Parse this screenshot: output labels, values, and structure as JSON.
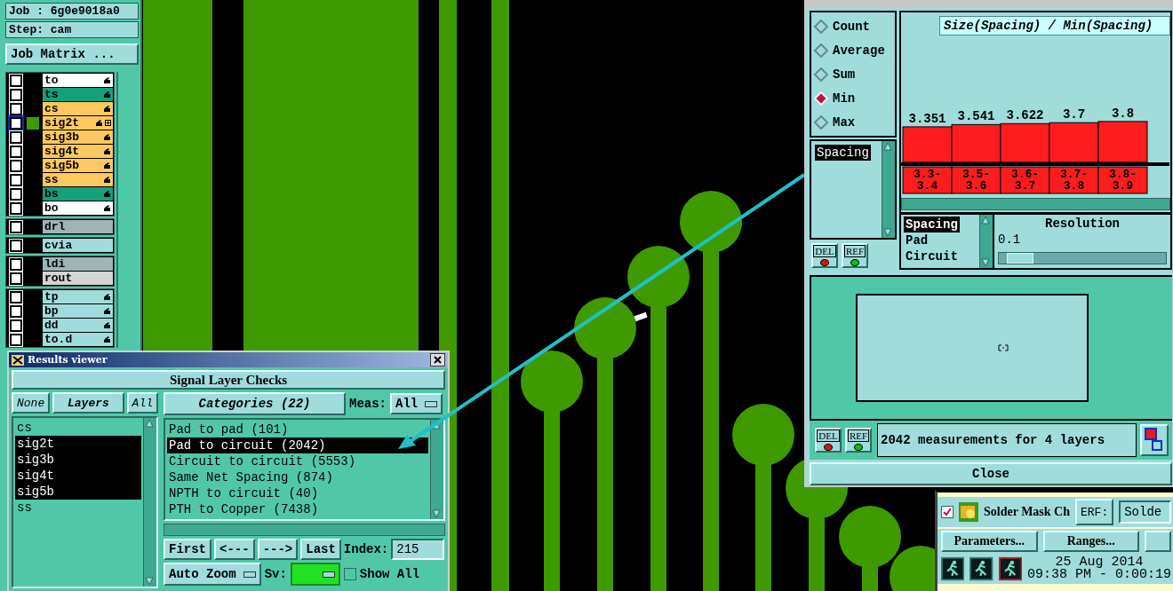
{
  "left_panel": {
    "job": "Job : 6g0e9018a0",
    "step": "Step: cam",
    "matrix_button": "Job Matrix ...",
    "layer_groups": [
      {
        "layers": [
          {
            "name": "to",
            "color": "#ffffff",
            "checked": false,
            "selected": false,
            "affected": true
          },
          {
            "name": "ts",
            "color": "#13a07a",
            "checked": false,
            "selected": false,
            "affected": true
          },
          {
            "name": "cs",
            "color": "#ffc860",
            "checked": false,
            "selected": false,
            "affected": true
          },
          {
            "name": "sig2t",
            "color": "#ffc860",
            "checked": false,
            "selected": true,
            "affected": true
          },
          {
            "name": "sig3b",
            "color": "#ffc860",
            "checked": false,
            "selected": false,
            "affected": true
          },
          {
            "name": "sig4t",
            "color": "#ffc860",
            "checked": false,
            "selected": false,
            "affected": true
          },
          {
            "name": "sig5b",
            "color": "#ffc860",
            "checked": false,
            "selected": false,
            "affected": true
          },
          {
            "name": "ss",
            "color": "#ffc860",
            "checked": false,
            "selected": false,
            "affected": true
          },
          {
            "name": "bs",
            "color": "#13a07a",
            "checked": false,
            "selected": false,
            "affected": true
          },
          {
            "name": "bo",
            "color": "#ffffff",
            "checked": false,
            "selected": false,
            "affected": true
          }
        ]
      },
      {
        "layers": [
          {
            "name": "drl",
            "color": "#a0b4b8",
            "checked": false,
            "selected": false,
            "affected": false
          }
        ]
      },
      {
        "layers": [
          {
            "name": "cvia",
            "color": "#a0dcdc",
            "checked": false,
            "selected": false,
            "affected": false
          }
        ]
      },
      {
        "layers": [
          {
            "name": "ldi",
            "color": "#a0b4b8",
            "checked": false,
            "selected": false,
            "affected": false
          },
          {
            "name": "rout",
            "color": "#d4d4d4",
            "checked": false,
            "selected": false,
            "affected": false
          }
        ]
      },
      {
        "layers": [
          {
            "name": "tp",
            "color": "#a0dcdc",
            "checked": false,
            "selected": false,
            "affected": true
          },
          {
            "name": "bp",
            "color": "#a0dcdc",
            "checked": false,
            "selected": false,
            "affected": true
          },
          {
            "name": "dd",
            "color": "#a0dcdc",
            "checked": false,
            "selected": false,
            "affected": true
          },
          {
            "name": "to.d",
            "color": "#a0dcdc",
            "checked": false,
            "selected": false,
            "affected": true
          }
        ]
      }
    ]
  },
  "results_viewer": {
    "title": "Results viewer",
    "heading": "Signal Layer Checks",
    "layer_buttons": [
      "None",
      "Layers",
      "All"
    ],
    "layers": [
      {
        "name": "cs",
        "selected": false
      },
      {
        "name": "sig2t",
        "selected": true
      },
      {
        "name": "sig3b",
        "selected": true
      },
      {
        "name": "sig4t",
        "selected": true
      },
      {
        "name": "sig5b",
        "selected": true
      },
      {
        "name": "ss",
        "selected": false
      }
    ],
    "categories_button": "Categories (22)",
    "meas_label": "Meas:",
    "meas_value": "All",
    "categories": [
      {
        "label": "Pad to pad (101)",
        "selected": false
      },
      {
        "label": "Pad to circuit (2042)",
        "selected": true
      },
      {
        "label": "Circuit to circuit (5553)",
        "selected": false
      },
      {
        "label": "Same Net Spacing (874)",
        "selected": false
      },
      {
        "label": "NPTH to circuit (40)",
        "selected": false
      },
      {
        "label": "PTH to Copper (7438)",
        "selected": false
      }
    ],
    "nav_buttons": [
      "First",
      "<---",
      "--->",
      "Last"
    ],
    "index_label": "Index:",
    "index_value": "215",
    "zoom_mode": "Auto Zoom",
    "sv_label": "Sv:",
    "show_all": {
      "label": "Show All",
      "checked": false
    }
  },
  "histogram": {
    "modes": [
      {
        "label": "Count",
        "selected": false
      },
      {
        "label": "Average",
        "selected": false
      },
      {
        "label": "Sum",
        "selected": false
      },
      {
        "label": "Min",
        "selected": true
      },
      {
        "label": "Max",
        "selected": false
      }
    ],
    "measures": [
      {
        "label": "Spacing",
        "selected": true
      }
    ],
    "side_buttons": [
      {
        "label": "DEL",
        "color": "#e01010"
      },
      {
        "label": "REF",
        "color": "#10c010"
      }
    ],
    "chart_data": {
      "type": "bar",
      "title": "Size(Spacing) / Min(Spacing)",
      "categories": [
        "3.3-3.4",
        "3.5-3.6",
        "3.6-3.7",
        "3.7-3.8",
        "3.8-3.9"
      ],
      "values": [
        3.351,
        3.541,
        3.622,
        3.7,
        3.8
      ],
      "data_labels": true
    },
    "attributes": [
      {
        "label": "Spacing",
        "selected": true
      },
      {
        "label": "Pad",
        "selected": false
      },
      {
        "label": "Circuit",
        "selected": false
      }
    ],
    "resolution_label": "Resolution",
    "resolution_value": "0.1",
    "resolution_slider": {
      "level": 0.05
    },
    "bottom_buttons": [
      {
        "label": "DEL",
        "color": "#e01010"
      },
      {
        "label": "REF",
        "color": "#10c010"
      }
    ],
    "status": "2042 measurements for 4 layers",
    "close": "Close"
  },
  "solder_mask": {
    "checked": true,
    "title": "Solder Mask Ch",
    "erf_button": "ERF:",
    "erf_value": "Solde",
    "buttons": [
      "Parameters...",
      "Ranges..."
    ],
    "date": "25 Aug 2014",
    "time": "09:38 PM - 0:00:19"
  }
}
